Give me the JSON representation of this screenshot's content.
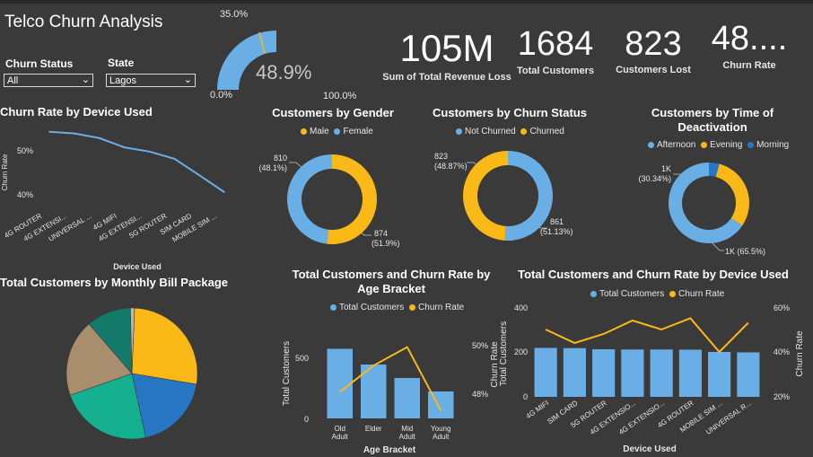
{
  "page": {
    "title": "Telco Churn Analysis"
  },
  "filters": {
    "churn_status": {
      "label": "Churn Status",
      "value": "All"
    },
    "state": {
      "label": "State",
      "value": "Lagos"
    }
  },
  "gauge": {
    "value_label": "48.9%",
    "value": 48.9,
    "target_label": "35.0%",
    "min_label": "0.0%",
    "max_label": "100.0%",
    "color": "#6aaee6"
  },
  "kpis": [
    {
      "value": "105M",
      "label": "Sum of Total Revenue Loss"
    },
    {
      "value": "1684",
      "label": "Total Customers"
    },
    {
      "value": "823",
      "label": "Customers Lost"
    },
    {
      "value": "48....",
      "label": "Churn Rate"
    }
  ],
  "colors": {
    "blue": "#6aaee6",
    "orange": "#fbb917",
    "darkblue": "#2776c4",
    "teal": "#14b08f",
    "darkteal": "#137a6a",
    "tan": "#a98e6e",
    "grey": "#b9b9b9"
  },
  "charts": {
    "churn_by_device": {
      "title": "Churn Rate by Device Used",
      "ylabel": "Churn Rate",
      "xlabel": "Device Used",
      "yticks": [
        "50%",
        "40%"
      ]
    },
    "gender": {
      "title": "Customers by Gender",
      "legend": [
        "Male",
        "Female"
      ],
      "label_a": "810",
      "label_a_pct": "(48.1%)",
      "label_b": "874",
      "label_b_pct": "(51.9%)"
    },
    "churn_status": {
      "title": "Customers by Churn Status",
      "legend": [
        "Not Churned",
        "Churned"
      ],
      "label_a": "823",
      "label_a_pct": "(48.87%)",
      "label_b": "861",
      "label_b_pct": "(51.13%)"
    },
    "deactivation": {
      "title_line1": "Customers by Time of",
      "title_line2": "Deactivation",
      "legend": [
        "Afternoon",
        "Evening",
        "Morning"
      ],
      "label_a": "1K",
      "label_a_pct": "(30.34%)",
      "label_b": "1K (65.5%)"
    },
    "bill_package": {
      "title": "Total Customers by Monthly Bill Package"
    },
    "age_bracket": {
      "title_line1": "Total Customers and Churn Rate by",
      "title_line2": "Age Bracket",
      "legend": [
        "Total Customers",
        "Churn Rate"
      ],
      "ylabel": "Total Customers",
      "y2label": "Churn Rate",
      "xlabel": "Age Bracket",
      "yticks": [
        "500",
        "0"
      ],
      "y2ticks": [
        "50%",
        "48%"
      ],
      "cats": [
        "Old\nAdult",
        "Elder",
        "Mid\nAdult",
        "Young\nAdult"
      ]
    },
    "device_combo": {
      "title": "Total Customers and Churn Rate by Device Used",
      "legend": [
        "Total Customers",
        "Churn Rate"
      ],
      "ylabel": "Total Customers",
      "y2label": "Churn Rate",
      "xlabel": "Device Used",
      "yticks": [
        "400",
        "200",
        "0"
      ],
      "y2ticks": [
        "60%",
        "40%",
        "20%"
      ]
    }
  },
  "chart_data": [
    {
      "type": "line",
      "title": "Churn Rate by Device Used",
      "categories": [
        "4G ROUTER",
        "4G EXTENSI...",
        "UNIVERSAL ...",
        "4G MIFI",
        "4G EXTENSI...",
        "5G ROUTER",
        "SIM CARD",
        "MOBILE SIM ..."
      ],
      "values": [
        54,
        53.6,
        52.5,
        50.3,
        49.3,
        47.6,
        43.7,
        39.7
      ],
      "ylabel": "Churn Rate",
      "xlabel": "Device Used",
      "ylim": [
        38,
        55
      ]
    },
    {
      "type": "pie",
      "title": "Customers by Gender",
      "labels": [
        "Male",
        "Female"
      ],
      "values": [
        874,
        810
      ]
    },
    {
      "type": "pie",
      "title": "Customers by Churn Status",
      "labels": [
        "Not Churned",
        "Churned"
      ],
      "values": [
        861,
        823
      ]
    },
    {
      "type": "pie",
      "title": "Customers by Time of Deactivation",
      "labels": [
        "Afternoon",
        "Evening",
        "Morning"
      ],
      "values": [
        65.5,
        30.34,
        4.16
      ]
    },
    {
      "type": "pie",
      "title": "Total Customers by Monthly Bill Package",
      "values": [
        27,
        19,
        23,
        19,
        11,
        1
      ]
    },
    {
      "type": "bar",
      "title": "Total Customers and Churn Rate by Age Bracket",
      "categories": [
        "Old Adult",
        "Elder",
        "Mid Adult",
        "Young Adult"
      ],
      "series": [
        {
          "name": "Total Customers",
          "values": [
            620,
            480,
            360,
            240
          ]
        },
        {
          "name": "Churn Rate",
          "values": [
            48.3,
            49.3,
            50.0,
            47.6
          ]
        }
      ],
      "ylim": [
        0,
        800
      ],
      "y2lim": [
        47.3,
        50.7
      ]
    },
    {
      "type": "bar",
      "title": "Total Customers and Churn Rate by Device Used",
      "categories": [
        "4G MIFI",
        "SIM CARD",
        "5G ROUTER",
        "4G EXTENSIO...",
        "4G EXTENSIO...",
        "4G ROUTER",
        "MOBILE SIM ...",
        "UNIVERSAL R..."
      ],
      "series": [
        {
          "name": "Total Customers",
          "values": [
            218,
            217,
            212,
            211,
            211,
            210,
            200,
            198
          ]
        },
        {
          "name": "Churn Rate",
          "values": [
            50,
            44,
            48,
            54,
            50,
            55,
            40,
            53
          ]
        }
      ],
      "ylim": [
        0,
        400
      ],
      "y2lim": [
        20,
        60
      ]
    }
  ]
}
